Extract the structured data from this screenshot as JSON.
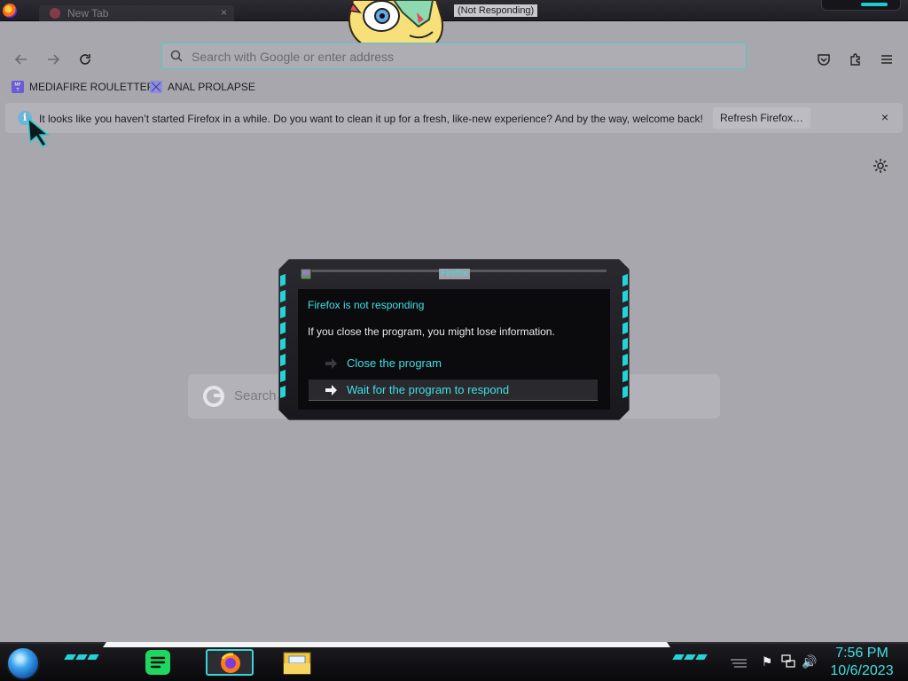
{
  "window": {
    "tab_label": "New Tab",
    "tab_close": "×",
    "title_text": "(Not Responding)"
  },
  "navbar": {
    "back_icon": "arrow-left-icon",
    "forward_icon": "arrow-right-icon",
    "reload_icon": "reload-icon",
    "url_placeholder": "Search with Google or enter address",
    "pocket_icon": "pocket-icon",
    "extensions_icon": "puzzle-icon",
    "menu_icon": "hamburger-icon"
  },
  "bookmarks": [
    {
      "label": "MEDIAFIRE ROULETTER",
      "icon": "mediafire-icon"
    },
    {
      "label": "ANAL PROLAPSE",
      "icon": "bookmark-icon"
    }
  ],
  "notification": {
    "message": "It looks like you haven’t started Firefox in a while. Do you want to clean it up for a fresh, like-new experience? And by the way, welcome back!",
    "button": "Refresh Firefox…",
    "close": "×",
    "info": "i"
  },
  "newtab": {
    "search_placeholder": "Search"
  },
  "dialog": {
    "title": "Firefox",
    "heading": "Firefox is not responding",
    "message": "If you close the program, you might lose information.",
    "options": [
      {
        "label": "Close the program"
      },
      {
        "label": "Wait for the program to respond"
      }
    ]
  },
  "taskbar": {
    "time": "7:56 PM",
    "date": "10/6/2023",
    "flag": "⚑",
    "volume": "🔊"
  },
  "colors": {
    "accent_cyan": "#3ee0e3",
    "page_bg": "#a8a7ad",
    "dialog_bg": "#0b0b0e"
  }
}
